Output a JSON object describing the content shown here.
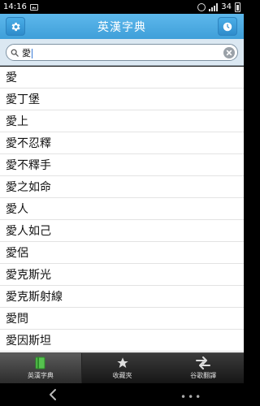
{
  "status_bar": {
    "time": "14:16",
    "signal_label": "34",
    "icons": [
      "image-icon",
      "alarm-icon",
      "signal-icon",
      "battery-icon"
    ]
  },
  "header": {
    "title": "英漢字典",
    "left_icon": "settings-gear-icon",
    "right_icon": "history-clock-icon"
  },
  "search": {
    "value": "愛",
    "search_icon": "magnifier-icon",
    "clear_icon": "clear-x-icon"
  },
  "results": [
    "愛",
    "愛丁堡",
    "愛上",
    "愛不忍釋",
    "愛不釋手",
    "愛之如命",
    "愛人",
    "愛人如己",
    "愛侶",
    "愛克斯光",
    "愛克斯射線",
    "愛問",
    "愛因斯坦"
  ],
  "tabs": [
    {
      "label": "英漢字典",
      "icon": "book-icon",
      "active": true
    },
    {
      "label": "收藏夾",
      "icon": "star-icon",
      "active": false
    },
    {
      "label": "谷歌翻譯",
      "icon": "translate-arrows-icon",
      "active": false
    }
  ],
  "nav": {
    "more_label": "•••"
  },
  "colors": {
    "header": "#4aaee7",
    "search_bg": "#dbe8f2",
    "tabbar": "#222222"
  }
}
